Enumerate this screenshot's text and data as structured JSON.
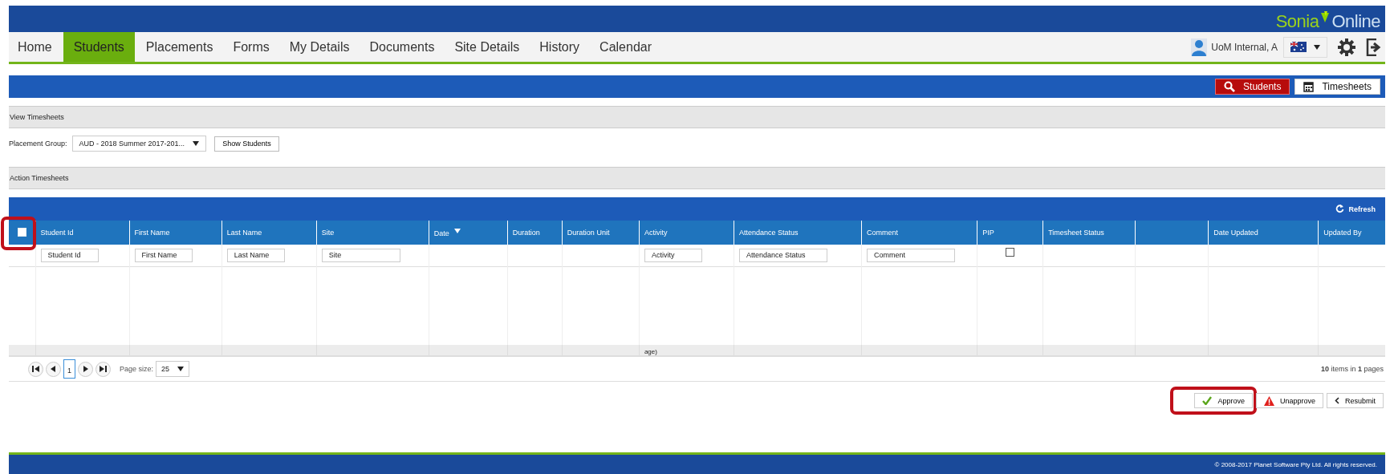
{
  "header": {
    "logo": {
      "first": "Sonia",
      "second": "Online"
    }
  },
  "nav": {
    "tabs": [
      {
        "label": "Home",
        "selected": false
      },
      {
        "label": "Students",
        "selected": true
      },
      {
        "label": "Placements",
        "selected": false
      },
      {
        "label": "Forms",
        "selected": false
      },
      {
        "label": "My Details",
        "selected": false
      },
      {
        "label": "Documents",
        "selected": false
      },
      {
        "label": "Site Details",
        "selected": false
      },
      {
        "label": "History",
        "selected": false
      },
      {
        "label": "Calendar",
        "selected": false
      }
    ],
    "user": "UoM Internal, A"
  },
  "toolbar": {
    "buttons": [
      {
        "label": "Students",
        "kind": "search",
        "selected": true
      },
      {
        "label": "Timesheets",
        "kind": "calendar",
        "selected": false
      }
    ]
  },
  "view_section": {
    "title": "View Timesheets",
    "group_label": "Placement Group:",
    "group_value": "AUD - 2018 Summer 2017-201...",
    "show_button": "Show Students"
  },
  "action_section": {
    "title": "Action Timesheets"
  },
  "grid": {
    "refresh": "Refresh",
    "select_all": {
      "checked": false,
      "highlighted": true
    },
    "columns": [
      {
        "label": "Student Id",
        "placeholder": "Student Id",
        "sorted": false
      },
      {
        "label": "First Name",
        "placeholder": "First Name",
        "sorted": false
      },
      {
        "label": "Last Name",
        "placeholder": "Last Name",
        "sorted": false
      },
      {
        "label": "Site",
        "placeholder": "Site",
        "sorted": false
      },
      {
        "label": "Date",
        "sorted": true
      },
      {
        "label": "Duration",
        "sorted": false
      },
      {
        "label": "Duration Unit",
        "sorted": false
      },
      {
        "label": "Activity",
        "placeholder": "Activity",
        "summary": "age)",
        "sorted": false
      },
      {
        "label": "Attendance Status",
        "placeholder": "Attendance Status",
        "sorted": false
      },
      {
        "label": "Comment",
        "placeholder": "Comment",
        "sorted": false
      },
      {
        "label": "PIP",
        "filter_checkbox": {
          "checked": false
        },
        "sorted": false
      },
      {
        "label": "Timesheet Status",
        "sorted": false
      },
      {
        "sorted": false
      },
      {
        "label": "Date Updated",
        "sorted": false
      },
      {
        "label": "Updated By",
        "sorted": false
      }
    ]
  },
  "pager": {
    "page": "1",
    "page_size_label": "Page size:",
    "page_size": "25",
    "info": "**10** items in **1** pages"
  },
  "actions": [
    {
      "label": "Approve",
      "kind": "approve",
      "highlighted": true
    },
    {
      "label": "Unapprove",
      "kind": "unapprove",
      "highlighted": false
    },
    {
      "label": "Resubmit",
      "kind": "resubmit",
      "highlighted": false
    }
  ],
  "footer": {
    "copyright": "© 2008-2017 Planet Software Pty Ltd. All rights reserved."
  }
}
